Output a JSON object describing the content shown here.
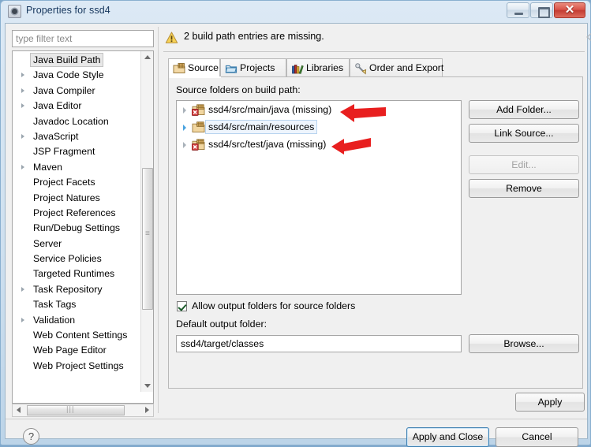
{
  "window": {
    "title": "Properties for ssd4",
    "icon": "eclipse-properties-icon",
    "controls": {
      "minimize": "minimize-icon",
      "maximize": "maximize-icon",
      "close": "✕"
    }
  },
  "sidebar": {
    "filter": {
      "placeholder": "type filter text",
      "value": ""
    },
    "items": [
      {
        "label": "Java Build Path",
        "expandable": false,
        "selected": true
      },
      {
        "label": "Java Code Style",
        "expandable": true,
        "selected": false
      },
      {
        "label": "Java Compiler",
        "expandable": true,
        "selected": false
      },
      {
        "label": "Java Editor",
        "expandable": true,
        "selected": false
      },
      {
        "label": "Javadoc Location",
        "expandable": false,
        "selected": false
      },
      {
        "label": "JavaScript",
        "expandable": true,
        "selected": false
      },
      {
        "label": "JSP Fragment",
        "expandable": false,
        "selected": false
      },
      {
        "label": "Maven",
        "expandable": true,
        "selected": false
      },
      {
        "label": "Project Facets",
        "expandable": false,
        "selected": false
      },
      {
        "label": "Project Natures",
        "expandable": false,
        "selected": false
      },
      {
        "label": "Project References",
        "expandable": false,
        "selected": false
      },
      {
        "label": "Run/Debug Settings",
        "expandable": false,
        "selected": false
      },
      {
        "label": "Server",
        "expandable": false,
        "selected": false
      },
      {
        "label": "Service Policies",
        "expandable": false,
        "selected": false
      },
      {
        "label": "Targeted Runtimes",
        "expandable": false,
        "selected": false
      },
      {
        "label": "Task Repository",
        "expandable": true,
        "selected": false
      },
      {
        "label": "Task Tags",
        "expandable": false,
        "selected": false
      },
      {
        "label": "Validation",
        "expandable": true,
        "selected": false
      },
      {
        "label": "Web Content Settings",
        "expandable": false,
        "selected": false
      },
      {
        "label": "Web Page Editor",
        "expandable": false,
        "selected": false
      },
      {
        "label": "Web Project Settings",
        "expandable": false,
        "selected": false
      }
    ]
  },
  "header": {
    "warning_icon": "warning-triangle-icon",
    "warning_text": "2 build path entries are missing.",
    "nav": {
      "back": "back-arrow-icon",
      "back_menu": "chevron-down-icon",
      "forward": "forward-arrow-icon",
      "forward_menu": "chevron-down-icon",
      "view_menu": "chevron-down-icon"
    }
  },
  "tabs": [
    {
      "label": "Source",
      "icon": "source-folder-icon",
      "active": true
    },
    {
      "label": "Projects",
      "icon": "projects-folder-icon",
      "active": false
    },
    {
      "label": "Libraries",
      "icon": "libraries-books-icon",
      "active": false
    },
    {
      "label": "Order and Export",
      "icon": "order-export-icon",
      "active": false
    }
  ],
  "source_page": {
    "list_label": "Source folders on build path:",
    "entries": [
      {
        "label": "ssd4/src/main/java (missing)",
        "missing": true,
        "selected": false
      },
      {
        "label": "ssd4/src/main/resources",
        "missing": false,
        "selected": true
      },
      {
        "label": "ssd4/src/test/java (missing)",
        "missing": true,
        "selected": false
      }
    ],
    "buttons": [
      {
        "label": "Add Folder...",
        "enabled": true
      },
      {
        "label": "Link Source...",
        "enabled": true
      },
      {
        "label": "Edit...",
        "enabled": false
      },
      {
        "label": "Remove",
        "enabled": true
      }
    ],
    "allow_output_folders": {
      "label": "Allow output folders for source folders",
      "checked": true
    },
    "default_output_label": "Default output folder:",
    "default_output_value": "ssd4/target/classes",
    "browse_label": "Browse...",
    "apply_label": "Apply"
  },
  "footer": {
    "help": "?",
    "apply_and_close": "Apply and Close",
    "cancel": "Cancel"
  },
  "annotations": {
    "arrow_color": "#e81f1f",
    "count": 2
  },
  "colors": {
    "accent_blue": "#3c7fb1",
    "close_red": "#c33d33",
    "title_text": "#15355c",
    "selection_bg": "#eef5fd",
    "annotation_red": "#e81f1f"
  }
}
